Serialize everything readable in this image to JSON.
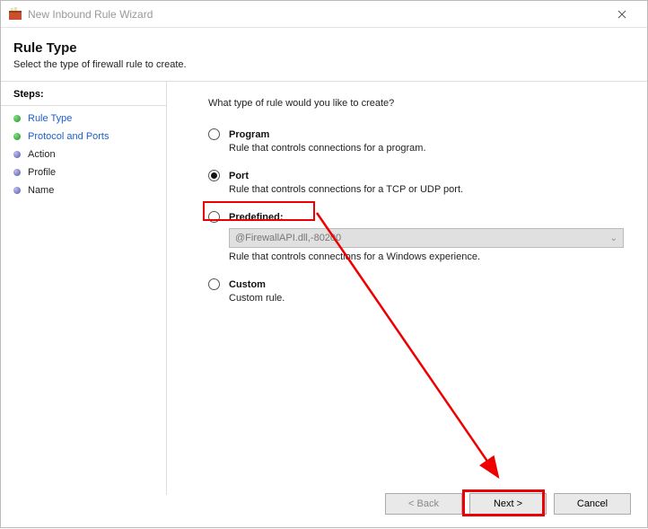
{
  "window": {
    "title": "New Inbound Rule Wizard"
  },
  "header": {
    "title": "Rule Type",
    "subtitle": "Select the type of firewall rule to create."
  },
  "sidebar": {
    "title": "Steps:",
    "items": [
      {
        "label": "Rule Type",
        "active": true
      },
      {
        "label": "Protocol and Ports",
        "active": true
      },
      {
        "label": "Action"
      },
      {
        "label": "Profile"
      },
      {
        "label": "Name"
      }
    ]
  },
  "content": {
    "prompt": "What type of rule would you like to create?",
    "options": [
      {
        "label": "Program",
        "desc": "Rule that controls connections for a program.",
        "selected": false
      },
      {
        "label": "Port",
        "desc": "Rule that controls connections for a TCP or UDP port.",
        "selected": true
      },
      {
        "label": "Predefined:",
        "desc": "Rule that controls connections for a Windows experience.",
        "selected": false,
        "dropdown": "@FirewallAPI.dll,-80200"
      },
      {
        "label": "Custom",
        "desc": "Custom rule.",
        "selected": false
      }
    ]
  },
  "buttons": {
    "back": "< Back",
    "next": "Next >",
    "cancel": "Cancel"
  }
}
